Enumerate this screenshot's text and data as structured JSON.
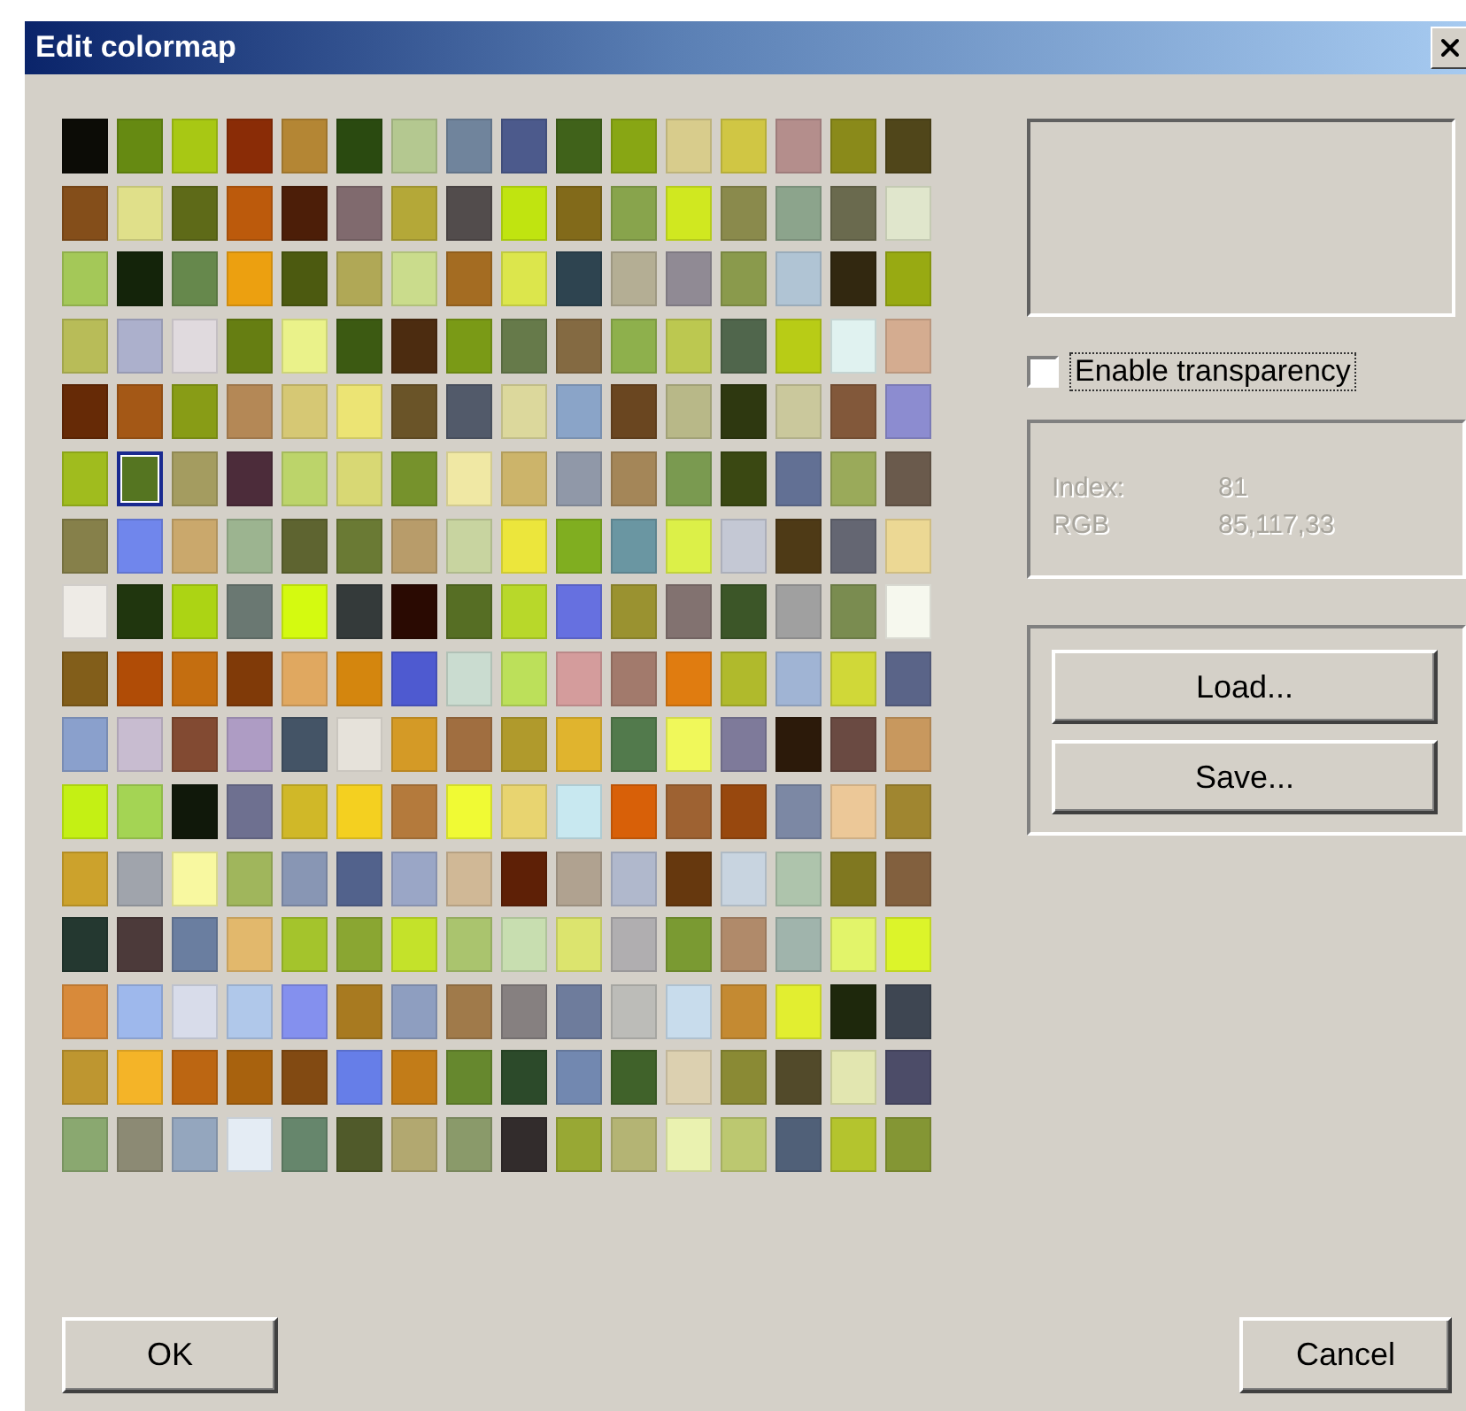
{
  "window": {
    "title": "Edit colormap"
  },
  "colormap": {
    "rows": [
      [
        {
          "color": "#0c0c06",
          "selected": false
        },
        {
          "color": "#668a12",
          "selected": false
        },
        {
          "color": "#a8c814",
          "selected": false
        },
        {
          "color": "#8a2c06",
          "selected": false
        },
        {
          "color": "#b48634",
          "selected": false
        },
        {
          "color": "#2a4a10",
          "selected": false
        },
        {
          "color": "#b4c890",
          "selected": false
        },
        {
          "color": "#70849c",
          "selected": false
        },
        {
          "color": "#4c5a8c",
          "selected": false
        },
        {
          "color": "#40621a",
          "selected": false
        },
        {
          "color": "#88a614",
          "selected": false
        },
        {
          "color": "#d8cc8c",
          "selected": false
        },
        {
          "color": "#d0c644",
          "selected": false
        },
        {
          "color": "#b48e8c",
          "selected": false
        },
        {
          "color": "#8a8a1a",
          "selected": false
        },
        {
          "color": "#50461a",
          "selected": false
        }
      ],
      [
        {
          "color": "#844e1a",
          "selected": false
        },
        {
          "color": "#e0e08a",
          "selected": false
        },
        {
          "color": "#5e6a18",
          "selected": false
        },
        {
          "color": "#bc5a0c",
          "selected": false
        },
        {
          "color": "#4c1e08",
          "selected": false
        },
        {
          "color": "#806a6e",
          "selected": false
        },
        {
          "color": "#b4a838",
          "selected": false
        },
        {
          "color": "#524c4c",
          "selected": false
        },
        {
          "color": "#c0e410",
          "selected": false
        },
        {
          "color": "#826a1a",
          "selected": false
        },
        {
          "color": "#88a44c",
          "selected": false
        },
        {
          "color": "#d0e820",
          "selected": false
        },
        {
          "color": "#8a8a4c",
          "selected": false
        },
        {
          "color": "#8ca48c",
          "selected": false
        },
        {
          "color": "#6a6a4e",
          "selected": false
        },
        {
          "color": "#e0e6cc",
          "selected": false
        }
      ],
      [
        {
          "color": "#a4c858",
          "selected": false
        },
        {
          "color": "#14240a",
          "selected": false
        },
        {
          "color": "#66884c",
          "selected": false
        },
        {
          "color": "#eca010",
          "selected": false
        },
        {
          "color": "#4c5a10",
          "selected": false
        },
        {
          "color": "#b0a856",
          "selected": false
        },
        {
          "color": "#cadc8c",
          "selected": false
        },
        {
          "color": "#a46c22",
          "selected": false
        },
        {
          "color": "#dce64c",
          "selected": false
        },
        {
          "color": "#2e4450",
          "selected": false
        },
        {
          "color": "#b4ae94",
          "selected": false
        },
        {
          "color": "#908a94",
          "selected": false
        },
        {
          "color": "#8a9a4c",
          "selected": false
        },
        {
          "color": "#b0c4d4",
          "selected": false
        },
        {
          "color": "#322810",
          "selected": false
        },
        {
          "color": "#98aa12",
          "selected": false
        }
      ],
      [
        {
          "color": "#b8bc58",
          "selected": false
        },
        {
          "color": "#acb0cc",
          "selected": false
        },
        {
          "color": "#e0dade",
          "selected": false
        },
        {
          "color": "#667e12",
          "selected": false
        },
        {
          "color": "#eaf28a",
          "selected": false
        },
        {
          "color": "#3c5a12",
          "selected": false
        },
        {
          "color": "#4c2c10",
          "selected": false
        },
        {
          "color": "#7a9a16",
          "selected": false
        },
        {
          "color": "#667a4a",
          "selected": false
        },
        {
          "color": "#846a42",
          "selected": false
        },
        {
          "color": "#8eb04c",
          "selected": false
        },
        {
          "color": "#bcc850",
          "selected": false
        },
        {
          "color": "#50664c",
          "selected": false
        },
        {
          "color": "#b8cc16",
          "selected": false
        },
        {
          "color": "#e0f2f0",
          "selected": false
        },
        {
          "color": "#d4ac90",
          "selected": false
        }
      ],
      [
        {
          "color": "#662a06",
          "selected": false
        },
        {
          "color": "#a45816",
          "selected": false
        },
        {
          "color": "#889c16",
          "selected": false
        },
        {
          "color": "#b48856",
          "selected": false
        },
        {
          "color": "#d6c874",
          "selected": false
        },
        {
          "color": "#ece474",
          "selected": false
        },
        {
          "color": "#6a5428",
          "selected": false
        },
        {
          "color": "#525a6a",
          "selected": false
        },
        {
          "color": "#dcd89c",
          "selected": false
        },
        {
          "color": "#8aa4c8",
          "selected": false
        },
        {
          "color": "#6a4620",
          "selected": false
        },
        {
          "color": "#b8b888",
          "selected": false
        },
        {
          "color": "#2e3810",
          "selected": false
        },
        {
          "color": "#cac89c",
          "selected": false
        },
        {
          "color": "#82583a",
          "selected": false
        },
        {
          "color": "#8c8cd0",
          "selected": false
        }
      ],
      [
        {
          "color": "#a0bc1e",
          "selected": false
        },
        {
          "color": "#557521",
          "selected": true
        },
        {
          "color": "#a49c60",
          "selected": false
        },
        {
          "color": "#4c2c3a",
          "selected": false
        },
        {
          "color": "#bcd46a",
          "selected": false
        },
        {
          "color": "#d8d874",
          "selected": false
        },
        {
          "color": "#76922c",
          "selected": false
        },
        {
          "color": "#f0e8a4",
          "selected": false
        },
        {
          "color": "#ccb46a",
          "selected": false
        },
        {
          "color": "#9098a8",
          "selected": false
        },
        {
          "color": "#a48658",
          "selected": false
        },
        {
          "color": "#7a9a50",
          "selected": false
        },
        {
          "color": "#3a4812",
          "selected": false
        },
        {
          "color": "#627094",
          "selected": false
        },
        {
          "color": "#9aaa5a",
          "selected": false
        },
        {
          "color": "#6a5a4c",
          "selected": false
        }
      ],
      [
        {
          "color": "#86804a",
          "selected": false
        },
        {
          "color": "#7086ec",
          "selected": false
        },
        {
          "color": "#caa86c",
          "selected": false
        },
        {
          "color": "#9cb490",
          "selected": false
        },
        {
          "color": "#5e6430",
          "selected": false
        },
        {
          "color": "#6a7a34",
          "selected": false
        },
        {
          "color": "#b89c6a",
          "selected": false
        },
        {
          "color": "#c8d4a0",
          "selected": false
        },
        {
          "color": "#ece63c",
          "selected": false
        },
        {
          "color": "#80ae20",
          "selected": false
        },
        {
          "color": "#6a96a2",
          "selected": false
        },
        {
          "color": "#dcf048",
          "selected": false
        },
        {
          "color": "#c4c8d4",
          "selected": false
        },
        {
          "color": "#4e3a16",
          "selected": false
        },
        {
          "color": "#646672",
          "selected": false
        },
        {
          "color": "#ecd894",
          "selected": false
        }
      ],
      [
        {
          "color": "#eeebe6",
          "selected": false
        },
        {
          "color": "#20360e",
          "selected": false
        },
        {
          "color": "#acd414",
          "selected": false
        },
        {
          "color": "#6a7872",
          "selected": false
        },
        {
          "color": "#d4fa10",
          "selected": false
        },
        {
          "color": "#343a3a",
          "selected": false
        },
        {
          "color": "#2a0a02",
          "selected": false
        },
        {
          "color": "#566e24",
          "selected": false
        },
        {
          "color": "#b8d82a",
          "selected": false
        },
        {
          "color": "#6670e0",
          "selected": false
        },
        {
          "color": "#9a9230",
          "selected": false
        },
        {
          "color": "#827270",
          "selected": false
        },
        {
          "color": "#3c5628",
          "selected": false
        },
        {
          "color": "#a0a0a0",
          "selected": false
        },
        {
          "color": "#7a8c50",
          "selected": false
        },
        {
          "color": "#f6f8ee",
          "selected": false
        }
      ],
      [
        {
          "color": "#825e1a",
          "selected": false
        },
        {
          "color": "#b04c06",
          "selected": false
        },
        {
          "color": "#c46e10",
          "selected": false
        },
        {
          "color": "#803a08",
          "selected": false
        },
        {
          "color": "#e0a860",
          "selected": false
        },
        {
          "color": "#d4860e",
          "selected": false
        },
        {
          "color": "#4e5ad0",
          "selected": false
        },
        {
          "color": "#cadcd0",
          "selected": false
        },
        {
          "color": "#bce05a",
          "selected": false
        },
        {
          "color": "#d49c9c",
          "selected": false
        },
        {
          "color": "#a27a6c",
          "selected": false
        },
        {
          "color": "#e07c10",
          "selected": false
        },
        {
          "color": "#b0ba2c",
          "selected": false
        },
        {
          "color": "#a0b4d4",
          "selected": false
        },
        {
          "color": "#d0d838",
          "selected": false
        },
        {
          "color": "#5a6488",
          "selected": false
        }
      ],
      [
        {
          "color": "#8aa0cc",
          "selected": false
        },
        {
          "color": "#c8bcd0",
          "selected": false
        },
        {
          "color": "#824a32",
          "selected": false
        },
        {
          "color": "#ae9cc4",
          "selected": false
        },
        {
          "color": "#445466",
          "selected": false
        },
        {
          "color": "#e6e2da",
          "selected": false
        },
        {
          "color": "#d49a26",
          "selected": false
        },
        {
          "color": "#a06e40",
          "selected": false
        },
        {
          "color": "#b09a2c",
          "selected": false
        },
        {
          "color": "#e0b42e",
          "selected": false
        },
        {
          "color": "#527a4c",
          "selected": false
        },
        {
          "color": "#f0f85a",
          "selected": false
        },
        {
          "color": "#7e7a9a",
          "selected": false
        },
        {
          "color": "#2c1a0a",
          "selected": false
        },
        {
          "color": "#6a4a42",
          "selected": false
        },
        {
          "color": "#c8985e",
          "selected": false
        }
      ],
      [
        {
          "color": "#c4f014",
          "selected": false
        },
        {
          "color": "#a4d454",
          "selected": false
        },
        {
          "color": "#10180a",
          "selected": false
        },
        {
          "color": "#6e7090",
          "selected": false
        },
        {
          "color": "#d0b828",
          "selected": false
        },
        {
          "color": "#f4d020",
          "selected": false
        },
        {
          "color": "#b47a3c",
          "selected": false
        },
        {
          "color": "#f0fa34",
          "selected": false
        },
        {
          "color": "#e8d470",
          "selected": false
        },
        {
          "color": "#c8e8f0",
          "selected": false
        },
        {
          "color": "#d86008",
          "selected": false
        },
        {
          "color": "#9e6232",
          "selected": false
        },
        {
          "color": "#98480e",
          "selected": false
        },
        {
          "color": "#7c88a4",
          "selected": false
        },
        {
          "color": "#ecc898",
          "selected": false
        },
        {
          "color": "#a08630",
          "selected": false
        }
      ],
      [
        {
          "color": "#cca22c",
          "selected": false
        },
        {
          "color": "#a0a4ac",
          "selected": false
        },
        {
          "color": "#f8f8a0",
          "selected": false
        },
        {
          "color": "#a0b65c",
          "selected": false
        },
        {
          "color": "#8896b4",
          "selected": false
        },
        {
          "color": "#52628c",
          "selected": false
        },
        {
          "color": "#9aa6c6",
          "selected": false
        },
        {
          "color": "#d0b896",
          "selected": false
        },
        {
          "color": "#5e2006",
          "selected": false
        },
        {
          "color": "#b0a290",
          "selected": false
        },
        {
          "color": "#b0b8cc",
          "selected": false
        },
        {
          "color": "#66380e",
          "selected": false
        },
        {
          "color": "#c8d4e0",
          "selected": false
        },
        {
          "color": "#aec4ac",
          "selected": false
        },
        {
          "color": "#807820",
          "selected": false
        },
        {
          "color": "#82603e",
          "selected": false
        }
      ],
      [
        {
          "color": "#243830",
          "selected": false
        },
        {
          "color": "#4c3a3a",
          "selected": false
        },
        {
          "color": "#6a7ea0",
          "selected": false
        },
        {
          "color": "#e2b86c",
          "selected": false
        },
        {
          "color": "#a4c42c",
          "selected": false
        },
        {
          "color": "#8aa632",
          "selected": false
        },
        {
          "color": "#c4e22a",
          "selected": false
        },
        {
          "color": "#aac46e",
          "selected": false
        },
        {
          "color": "#c8deb0",
          "selected": false
        },
        {
          "color": "#dce46e",
          "selected": false
        },
        {
          "color": "#b0aeb0",
          "selected": false
        },
        {
          "color": "#7a9a32",
          "selected": false
        },
        {
          "color": "#b08a6a",
          "selected": false
        },
        {
          "color": "#a0b4ac",
          "selected": false
        },
        {
          "color": "#e2f46a",
          "selected": false
        },
        {
          "color": "#dcf42a",
          "selected": false
        }
      ],
      [
        {
          "color": "#d88a3a",
          "selected": false
        },
        {
          "color": "#9eb8ec",
          "selected": false
        },
        {
          "color": "#d8dcea",
          "selected": false
        },
        {
          "color": "#b0c8ea",
          "selected": false
        },
        {
          "color": "#8490ee",
          "selected": false
        },
        {
          "color": "#a87a20",
          "selected": false
        },
        {
          "color": "#8e9ec0",
          "selected": false
        },
        {
          "color": "#a07a4a",
          "selected": false
        },
        {
          "color": "#868080",
          "selected": false
        },
        {
          "color": "#6e7c9c",
          "selected": false
        },
        {
          "color": "#bcbcb8",
          "selected": false
        },
        {
          "color": "#c8dcec",
          "selected": false
        },
        {
          "color": "#c48a32",
          "selected": false
        },
        {
          "color": "#e2ee30",
          "selected": false
        },
        {
          "color": "#1e280c",
          "selected": false
        },
        {
          "color": "#3e4652",
          "selected": false
        }
      ],
      [
        {
          "color": "#be9630",
          "selected": false
        },
        {
          "color": "#f4b428",
          "selected": false
        },
        {
          "color": "#bc6612",
          "selected": false
        },
        {
          "color": "#a8620e",
          "selected": false
        },
        {
          "color": "#824a12",
          "selected": false
        },
        {
          "color": "#667ee8",
          "selected": false
        },
        {
          "color": "#c27c18",
          "selected": false
        },
        {
          "color": "#66882e",
          "selected": false
        },
        {
          "color": "#2c4a2a",
          "selected": false
        },
        {
          "color": "#7288b0",
          "selected": false
        },
        {
          "color": "#40622a",
          "selected": false
        },
        {
          "color": "#dcd0b0",
          "selected": false
        },
        {
          "color": "#8a8a34",
          "selected": false
        },
        {
          "color": "#524a2a",
          "selected": false
        },
        {
          "color": "#e2e6b0",
          "selected": false
        },
        {
          "color": "#4c4c68",
          "selected": false
        }
      ],
      [
        {
          "color": "#8aa870",
          "selected": false
        },
        {
          "color": "#8c8a74",
          "selected": false
        },
        {
          "color": "#94a6be",
          "selected": false
        },
        {
          "color": "#e4ecf4",
          "selected": false
        },
        {
          "color": "#66866c",
          "selected": false
        },
        {
          "color": "#505a2a",
          "selected": false
        },
        {
          "color": "#b2a870",
          "selected": false
        },
        {
          "color": "#8a9a6a",
          "selected": false
        },
        {
          "color": "#322c2c",
          "selected": false
        },
        {
          "color": "#98a834",
          "selected": false
        },
        {
          "color": "#b4b474",
          "selected": false
        },
        {
          "color": "#eaf2b0",
          "selected": false
        },
        {
          "color": "#bcc870",
          "selected": false
        },
        {
          "color": "#506078",
          "selected": false
        },
        {
          "color": "#b4c42e",
          "selected": false
        },
        {
          "color": "#849634",
          "selected": false
        }
      ]
    ]
  },
  "transparency": {
    "label": "Enable transparency",
    "checked": false
  },
  "info": {
    "disabled": true,
    "rows": [
      {
        "label": "Index:",
        "value": "81"
      },
      {
        "label": "RGB",
        "value": "85,117,33"
      }
    ]
  },
  "file_buttons": [
    "Load...",
    "Save..."
  ],
  "footer": {
    "ok": "OK",
    "cancel": "Cancel"
  }
}
